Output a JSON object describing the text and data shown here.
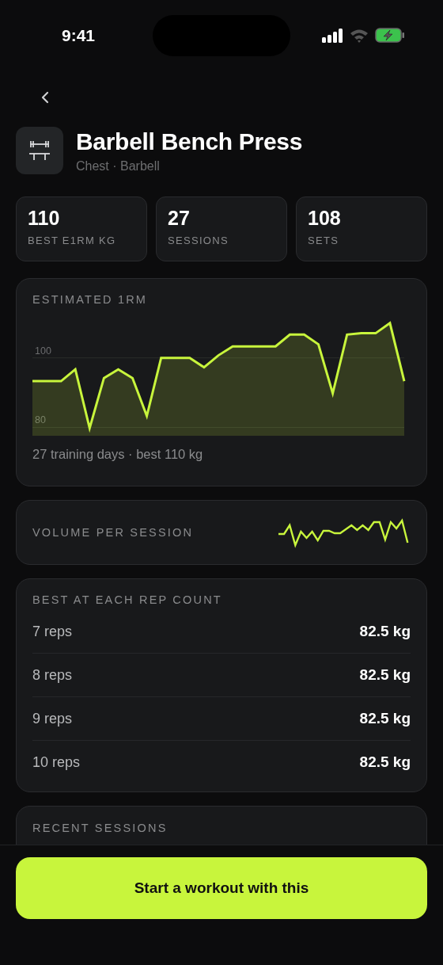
{
  "status_bar": {
    "time": "9:41"
  },
  "exercise": {
    "name": "Barbell Bench Press",
    "subtitle": "Chest · Barbell"
  },
  "stats": [
    {
      "value": "110",
      "label": "BEST E1RM KG"
    },
    {
      "value": "27",
      "label": "SESSIONS"
    },
    {
      "value": "108",
      "label": "SETS"
    }
  ],
  "estimated_1rm": {
    "title": "ESTIMATED 1RM",
    "chart_data": {
      "type": "area",
      "ylim": [
        77.6,
        112.7
      ],
      "yticks": [
        80,
        100
      ],
      "series": [
        {
          "color": "#c8f53c",
          "values": [
            93.3,
            93.3,
            93.3,
            96.7,
            79.8,
            94.2,
            96.7,
            94.2,
            83.3,
            100,
            100,
            100,
            97.3,
            100.7,
            103.3,
            103.3,
            103.3,
            103.3,
            106.7,
            106.7,
            103.9,
            89.8,
            106.7,
            107.1,
            107.1,
            110,
            93.3
          ]
        }
      ]
    },
    "summary": "27 training days · best 110 kg"
  },
  "volume": {
    "title": "VOLUME PER SESSION"
  },
  "rep_bests": {
    "title": "BEST AT EACH REP COUNT",
    "rows": [
      {
        "reps": "7 reps",
        "weight": "82.5 kg"
      },
      {
        "reps": "8 reps",
        "weight": "82.5 kg"
      },
      {
        "reps": "9 reps",
        "weight": "82.5 kg"
      },
      {
        "reps": "10 reps",
        "weight": "82.5 kg"
      }
    ]
  },
  "recent_sessions": {
    "title": "RECENT SESSIONS"
  },
  "action_button": {
    "label": "Start a workout with this"
  }
}
